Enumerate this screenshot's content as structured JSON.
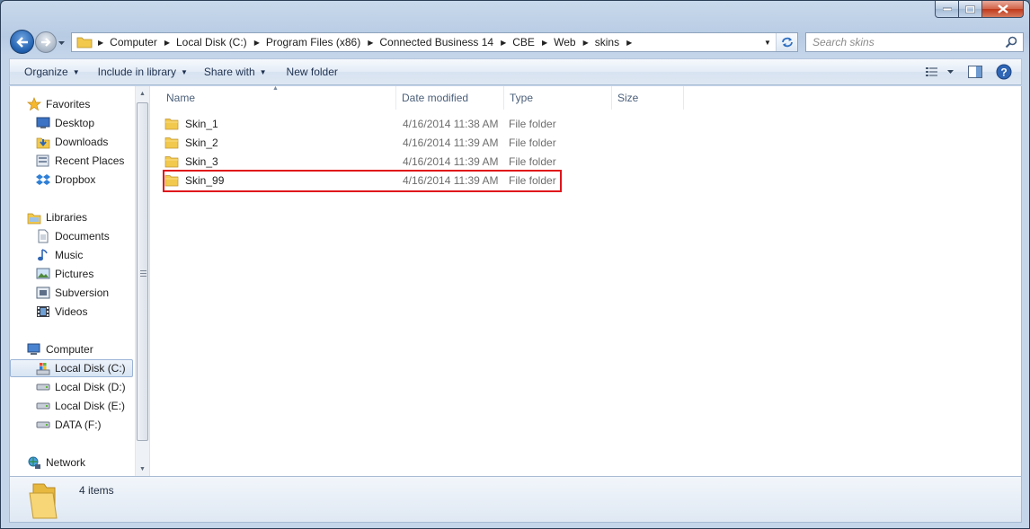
{
  "address": {
    "crumbs": [
      "Computer",
      "Local Disk (C:)",
      "Program Files (x86)",
      "Connected Business 14",
      "CBE",
      "Web",
      "skins"
    ]
  },
  "search": {
    "placeholder": "Search skins"
  },
  "commands": {
    "organize": "Organize",
    "include_in_library": "Include in library",
    "share_with": "Share with",
    "new_folder": "New folder"
  },
  "nav": {
    "favorites": "Favorites",
    "desktop": "Desktop",
    "downloads": "Downloads",
    "recent_places": "Recent Places",
    "dropbox": "Dropbox",
    "libraries": "Libraries",
    "documents": "Documents",
    "music": "Music",
    "pictures": "Pictures",
    "subversion": "Subversion",
    "videos": "Videos",
    "computer": "Computer",
    "local_c": "Local Disk (C:)",
    "local_d": "Local Disk (D:)",
    "local_e": "Local Disk (E:)",
    "data_f": "DATA (F:)",
    "network": "Network"
  },
  "columns": {
    "name": "Name",
    "date": "Date modified",
    "type": "Type",
    "size": "Size"
  },
  "files": [
    {
      "name": "Skin_1",
      "date": "4/16/2014 11:38 AM",
      "type": "File folder"
    },
    {
      "name": "Skin_2",
      "date": "4/16/2014 11:39 AM",
      "type": "File folder"
    },
    {
      "name": "Skin_3",
      "date": "4/16/2014 11:39 AM",
      "type": "File folder"
    },
    {
      "name": "Skin_99",
      "date": "4/16/2014 11:39 AM",
      "type": "File folder"
    }
  ],
  "status": {
    "count": "4 items"
  },
  "colors": {
    "highlight": "#e0161b",
    "folder": "#f2c94c"
  }
}
